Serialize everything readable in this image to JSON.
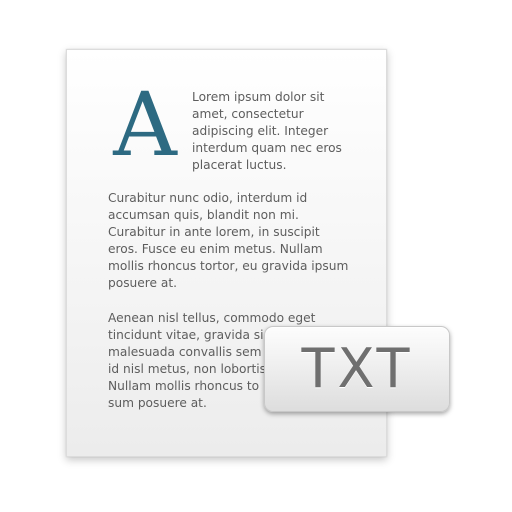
{
  "document_icon": {
    "dropcap": "A",
    "paragraphs": [
      "Lorem ipsum dolor sit\namet, consectetur\nadipiscing elit. Integer\ninterdum quam nec eros\nplacerat luctus.",
      "Curabitur nunc odio, interdum id\naccumsan quis, blandit non mi.\nCurabitur in ante lorem, in suscipit\neros. Fusce eu enim metus. Nullam\nmollis rhoncus tortor, eu gravida ipsum\nposuere at.",
      "Aenean nisl tellus, commodo eget\ntincidunt vitae, gravida si\nmalesuada convallis sem\nid nisl metus, non lobortis\nNullam mollis rhoncus to\nsum posuere at."
    ],
    "badge_label": "TXT"
  },
  "colors": {
    "dropcap": "#2d6a82",
    "body_text": "#5d5d5d",
    "badge_text": "#6f6f6f"
  }
}
